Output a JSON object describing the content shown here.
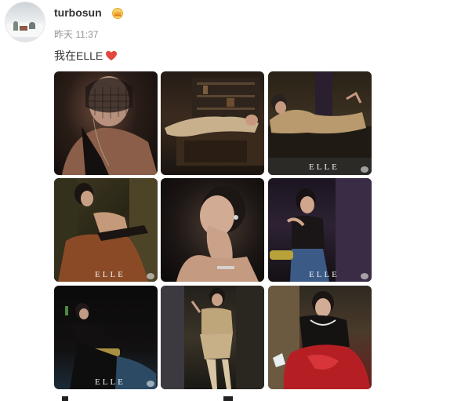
{
  "user": {
    "name": "turbosun",
    "badge_icon": "crown-icon"
  },
  "post": {
    "time": "昨天 11:37",
    "text": "我在ELLE",
    "emoji": "heart-icon"
  },
  "gallery": {
    "watermark_text": "ELLE",
    "images": [
      {
        "id": 1,
        "desc": "portrait-veil"
      },
      {
        "id": 2,
        "desc": "reclining-on-desk"
      },
      {
        "id": 3,
        "desc": "lying-on-sofa",
        "watermark": true
      },
      {
        "id": 4,
        "desc": "seated-chair-orange-skirt",
        "watermark": true
      },
      {
        "id": 5,
        "desc": "closeup-hand-on-face"
      },
      {
        "id": 6,
        "desc": "seated-jeans",
        "watermark": true
      },
      {
        "id": 7,
        "desc": "dark-reclining",
        "watermark": true
      },
      {
        "id": 8,
        "desc": "standing-patterned-outfit"
      },
      {
        "id": 9,
        "desc": "red-dress-seated"
      }
    ]
  },
  "colors": {
    "username": "#333333",
    "time": "#939393",
    "heart": "#e2463d"
  }
}
